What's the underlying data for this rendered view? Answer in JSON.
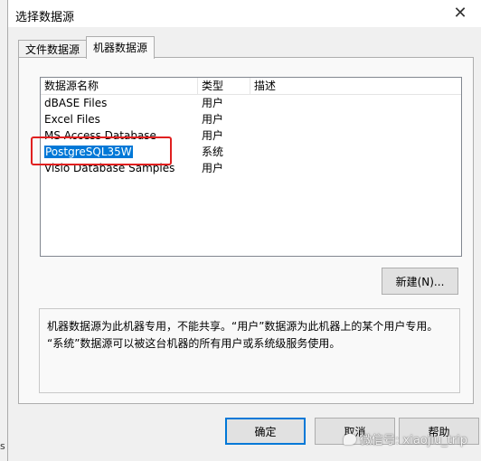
{
  "window": {
    "title": "选择数据源"
  },
  "tabs": [
    {
      "label": "文件数据源"
    },
    {
      "label": "机器数据源"
    }
  ],
  "list": {
    "columns": [
      "数据源名称",
      "类型",
      "描述"
    ],
    "rows": [
      {
        "name": "dBASE Files",
        "type": "用户",
        "desc": ""
      },
      {
        "name": "Excel Files",
        "type": "用户",
        "desc": ""
      },
      {
        "name": "MS Access Database",
        "type": "用户",
        "desc": ""
      },
      {
        "name": "PostgreSQL35W",
        "type": "系统",
        "desc": "",
        "selected": true
      },
      {
        "name": "Visio Database Samples",
        "type": "用户",
        "desc": ""
      }
    ]
  },
  "buttons": {
    "new": "新建(N)...",
    "ok": "确定",
    "cancel": "取消",
    "help": "帮助"
  },
  "description": {
    "line1": "机器数据源为此机器专用，不能共享。“用户”数据源为此机器上的某个用户专用。",
    "line2": "“系统”数据源可以被这台机器的所有用户或系统级服务使用。"
  },
  "watermark": {
    "text": "微信号: xiaojiu_trip"
  },
  "colors": {
    "selection": "#0078d7",
    "highlight_box": "#e02020"
  }
}
